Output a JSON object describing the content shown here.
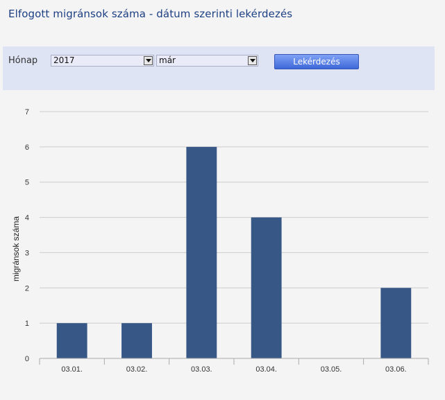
{
  "header": {
    "title": "Elfogott migránsok száma - dátum szerinti lekérdezés"
  },
  "filter": {
    "month_label": "Hónap",
    "year_value": "2017",
    "month_value": "már",
    "query_button_label": "Lekérdezés"
  },
  "chart_data": {
    "type": "bar",
    "title": "",
    "xlabel": "",
    "ylabel": "migránsok száma",
    "categories": [
      "03.01.",
      "03.02.",
      "03.03.",
      "03.04.",
      "03.05.",
      "03.06."
    ],
    "values": [
      1,
      1,
      6,
      4,
      0,
      2
    ],
    "ylim": [
      0,
      7
    ],
    "yticks": [
      0,
      1,
      2,
      3,
      4,
      5,
      6,
      7
    ],
    "grid": true,
    "bar_color": "#375787"
  }
}
